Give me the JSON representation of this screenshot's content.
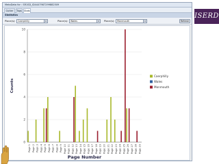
{
  "window": {
    "title": "MetaData for : SR1SD_ID4447987299882509",
    "tabs": [
      {
        "label": "Gutter Core",
        "active": false
      },
      {
        "label": "Tags",
        "active": false
      },
      {
        "label": "Stats",
        "active": true
      }
    ]
  },
  "section": {
    "title": "Statistics"
  },
  "filters": [
    {
      "label": "Place(s):",
      "value": "Caerphilly"
    },
    {
      "label": "Place(s):",
      "value": "Wales"
    },
    {
      "label": "Place(s):",
      "value": "Monmouth"
    }
  ],
  "refresh_label": "Refresh",
  "logo": {
    "text": "ISERD"
  },
  "colors": {
    "Caerphilly": "#a8b82a",
    "Wales": "#2f5f9e",
    "Monmouth": "#9a1d2d",
    "logo_bg": "#4a2359"
  },
  "chart_data": {
    "type": "bar",
    "xlabel": "Page Number",
    "ylabel": "Counts",
    "ylim": [
      0,
      10
    ],
    "yticks": [
      0,
      2,
      4,
      6,
      8,
      10
    ],
    "grid": true,
    "legend_placement": "right",
    "categories": [
      "Page 1",
      "Page 2",
      "Page 3",
      "Page 4",
      "Page 5",
      "Page 6",
      "Page 7",
      "Page 8",
      "Page 9",
      "Page 10",
      "Page 11",
      "Page 12",
      "Page 13",
      "Page 14",
      "Page 15",
      "Page 16",
      "Page 17",
      "Page 18",
      "Page 19",
      "Page 20",
      "Page 21",
      "Page 22",
      "Page 23",
      "Page 24",
      "Page 25",
      "Page 26",
      "Page 27",
      "Page 28",
      "Page 29"
    ],
    "series": [
      {
        "name": "Caerphilly",
        "values": [
          1,
          0,
          2,
          0,
          3,
          4,
          0,
          0,
          1,
          0,
          0,
          0,
          5,
          1,
          2,
          3,
          0,
          0,
          0,
          0,
          2,
          4,
          2,
          0,
          0,
          3,
          0,
          0,
          0
        ]
      },
      {
        "name": "Wales",
        "values": [
          0,
          0,
          0,
          0,
          0,
          0,
          0,
          0,
          0,
          0,
          0,
          0,
          0,
          0,
          0,
          0,
          0,
          0,
          0,
          0,
          0,
          0,
          0,
          0,
          0,
          0,
          0,
          0,
          0
        ]
      },
      {
        "name": "Monmouth",
        "values": [
          0,
          0,
          0,
          0,
          3,
          0,
          0,
          0,
          0,
          0,
          0,
          4,
          0,
          0,
          0,
          0,
          0,
          1,
          0,
          0,
          0,
          0,
          0,
          1,
          10,
          3,
          0,
          1,
          0
        ]
      }
    ]
  }
}
